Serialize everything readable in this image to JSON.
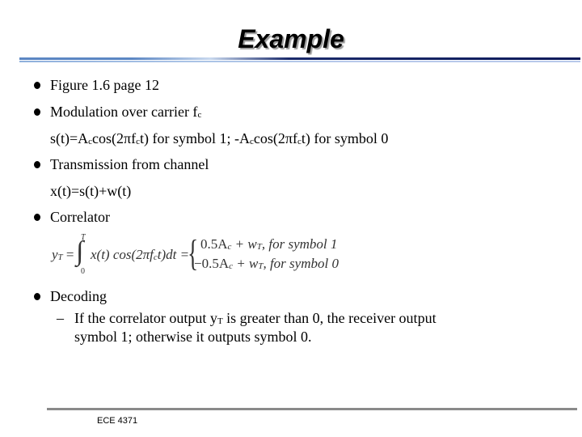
{
  "slide": {
    "title": "Example",
    "bullets": [
      {
        "text": "Figure 1.6 page 12"
      },
      {
        "text_main": "Modulation over carrier f",
        "text_sub": "c"
      },
      {
        "text": "Transmission from channel"
      },
      {
        "text": "Correlator"
      },
      {
        "text": "Decoding"
      }
    ],
    "modulation_eq": {
      "p1": "s(t)=A",
      "s1": "c",
      "p2": "cos(2πf",
      "s2": "c",
      "p3": "t) for symbol 1; -A",
      "s3": "c",
      "p4": "cos(2πf",
      "s4": "c",
      "p5": "t) for symbol 0"
    },
    "channel_eq": "x(t)=s(t)+w(t)",
    "correlator_formula": {
      "lhs": "y",
      "lhs_sub": "T",
      "equals": " =",
      "integral": "∫",
      "upper_limit": "T",
      "lower_limit": "0",
      "integrand": "x(t) cos(2πf",
      "integrand_sub": "c",
      "integrand_end": "t)dt =",
      "brace": "{",
      "case1_value": "0.5A",
      "case1_sub": "c",
      "case1_plus": " + w",
      "case1_wsub": "T",
      "case1_label": ", for symbol 1",
      "case2_value": "−0.5A",
      "case2_sub": "c",
      "case2_plus": " + w",
      "case2_wsub": "T",
      "case2_label": ", for symbol 0"
    },
    "decoding_sub": {
      "dash": "–",
      "line1_a": "If the correlator output y",
      "line1_sub": "T",
      "line1_b": " is greater than 0, the receiver output",
      "line2": "symbol 1; otherwise it outputs symbol 0."
    },
    "footer": "ECE 4371"
  }
}
